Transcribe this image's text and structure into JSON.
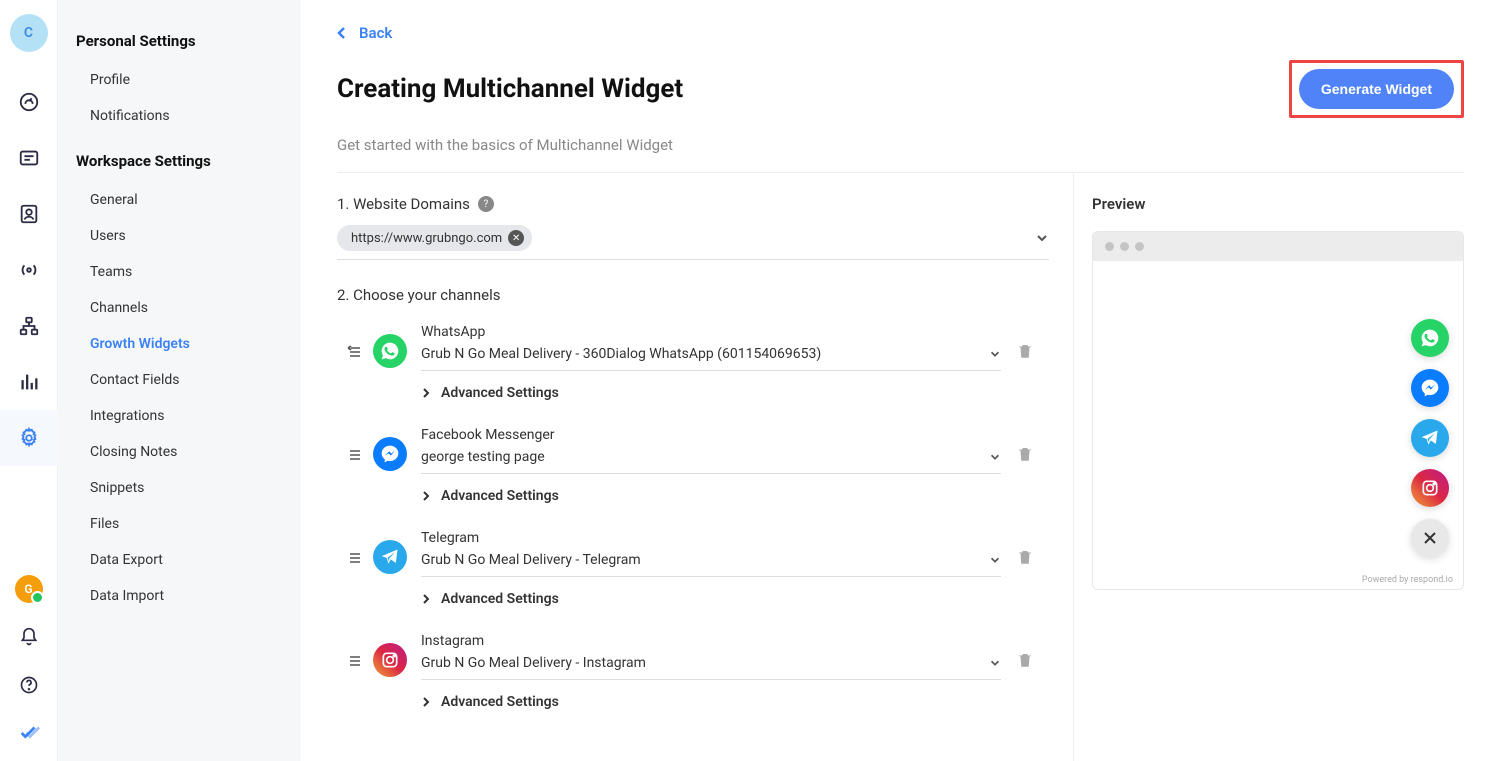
{
  "rail": {
    "avatar_letter": "C",
    "bottom_avatar_letter": "G"
  },
  "sidebar": {
    "personal_section": "Personal Settings",
    "workspace_section": "Workspace Settings",
    "personal_items": [
      "Profile",
      "Notifications"
    ],
    "workspace_items": [
      "General",
      "Users",
      "Teams",
      "Channels",
      "Growth Widgets",
      "Contact Fields",
      "Integrations",
      "Closing Notes",
      "Snippets",
      "Files",
      "Data Export",
      "Data Import"
    ],
    "active_item": "Growth Widgets"
  },
  "page": {
    "back_label": "Back",
    "title": "Creating Multichannel Widget",
    "subtitle": "Get started with the basics of Multichannel Widget",
    "generate_button": "Generate Widget"
  },
  "steps": {
    "domains_label": "1. Website Domains",
    "channels_label": "2. Choose your channels",
    "domain_value": "https://www.grubngo.com"
  },
  "channels": [
    {
      "type": "whatsapp",
      "name": "WhatsApp",
      "value": "Grub N Go Meal Delivery - 360Dialog WhatsApp (601154069653)",
      "advanced": "Advanced Settings"
    },
    {
      "type": "messenger",
      "name": "Facebook Messenger",
      "value": "george testing page",
      "advanced": "Advanced Settings"
    },
    {
      "type": "telegram",
      "name": "Telegram",
      "value": "Grub N Go Meal Delivery - Telegram",
      "advanced": "Advanced Settings"
    },
    {
      "type": "instagram",
      "name": "Instagram",
      "value": "Grub N Go Meal Delivery - Instagram",
      "advanced": "Advanced Settings"
    }
  ],
  "preview": {
    "title": "Preview",
    "footer": "Powered by respond.io"
  }
}
